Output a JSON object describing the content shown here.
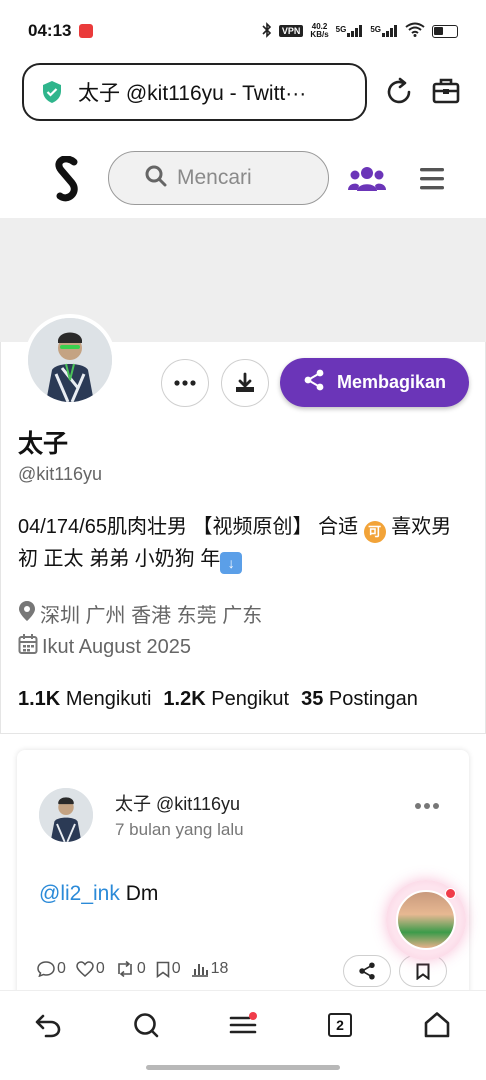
{
  "status_bar": {
    "time": "04:13",
    "vpn": "VPN",
    "speed_value": "40.2",
    "speed_unit": "KB/s",
    "signal1": "5G",
    "signal2": "5G"
  },
  "browser": {
    "address_text": "太子 @kit116yu - Twitt···",
    "tab_count": "2"
  },
  "site": {
    "search_placeholder": "Mencari"
  },
  "profile": {
    "share_label": "Membagikan",
    "display_name": "太子",
    "handle": "@kit116yu",
    "bio_part1": "04/174/65肌肉壮男 【视频原创】 合适 ",
    "bio_coin": "可",
    "bio_part2": " 喜欢男初 正太 弟弟 小奶狗 年",
    "location": "深圳 广州 香港 东莞 广东",
    "joined": "Ikut August 2025",
    "following_count": "1.1K",
    "following_label": "Mengikuti",
    "followers_count": "1.2K",
    "followers_label": "Pengikut",
    "posts_count": "35",
    "posts_label": "Postingan"
  },
  "tweet": {
    "author": "太子 @kit116yu",
    "time": "7 bulan yang lalu",
    "mention": "@li2_ink",
    "text": " Dm",
    "replies": "0",
    "likes": "0",
    "retweets": "0",
    "bookmarks": "0",
    "views": "18"
  },
  "colors": {
    "accent": "#6b35b8",
    "mention": "#2b8ad8",
    "notification_dot": "#f03c4a"
  }
}
